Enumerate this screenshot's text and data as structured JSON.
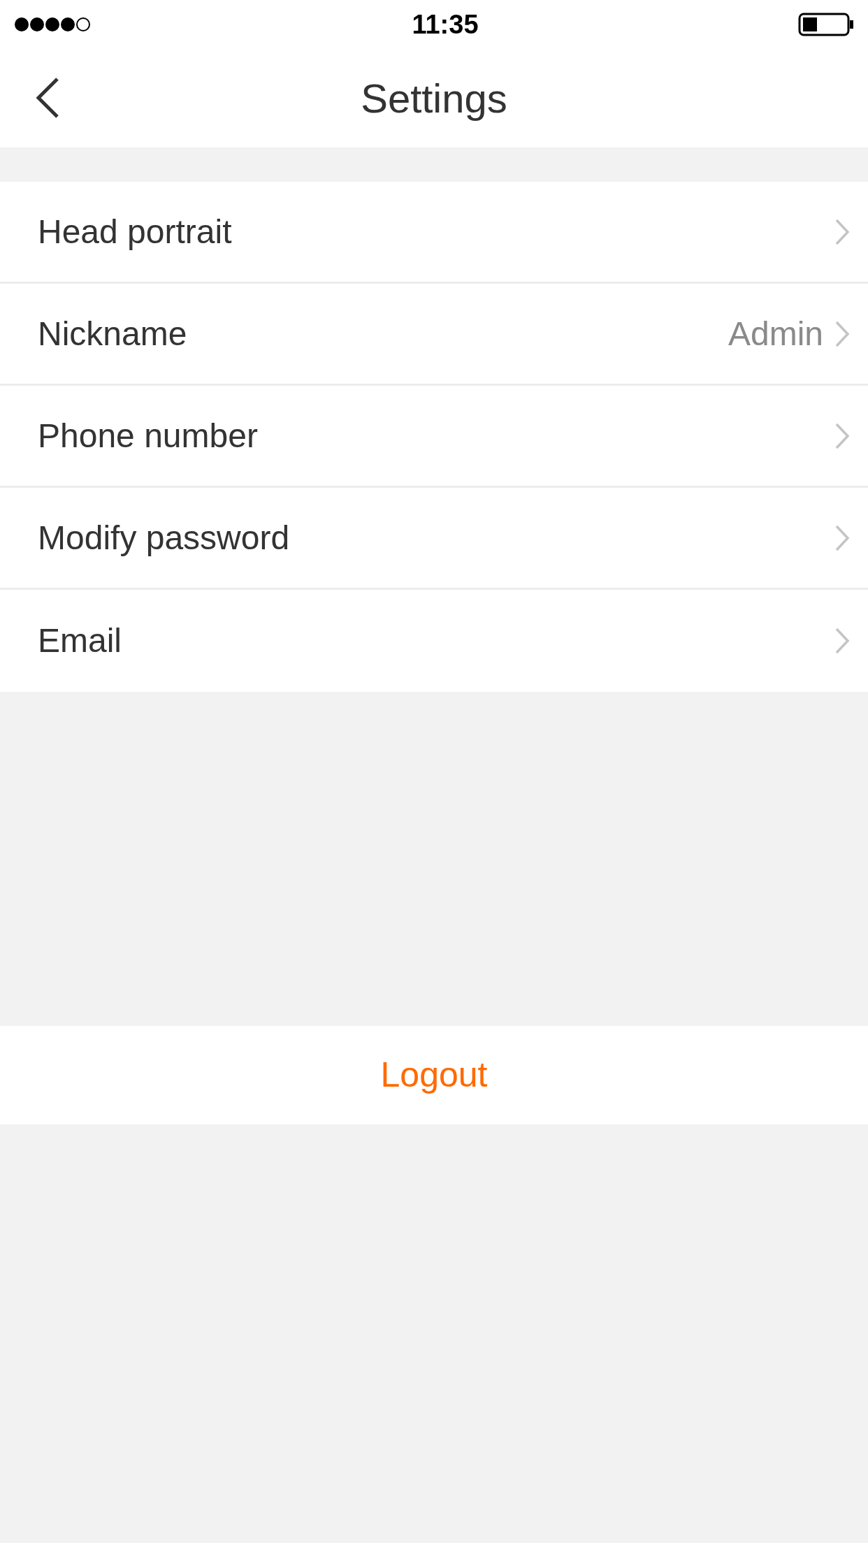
{
  "status_bar": {
    "time": "11:35"
  },
  "nav": {
    "title": "Settings"
  },
  "rows": [
    {
      "label": "Head portrait"
    },
    {
      "label": "Nickname",
      "value": "Admin"
    },
    {
      "label": "Phone number"
    },
    {
      "label": "Modify password"
    },
    {
      "label": "Email"
    }
  ],
  "logout": {
    "label": "Logout"
  }
}
